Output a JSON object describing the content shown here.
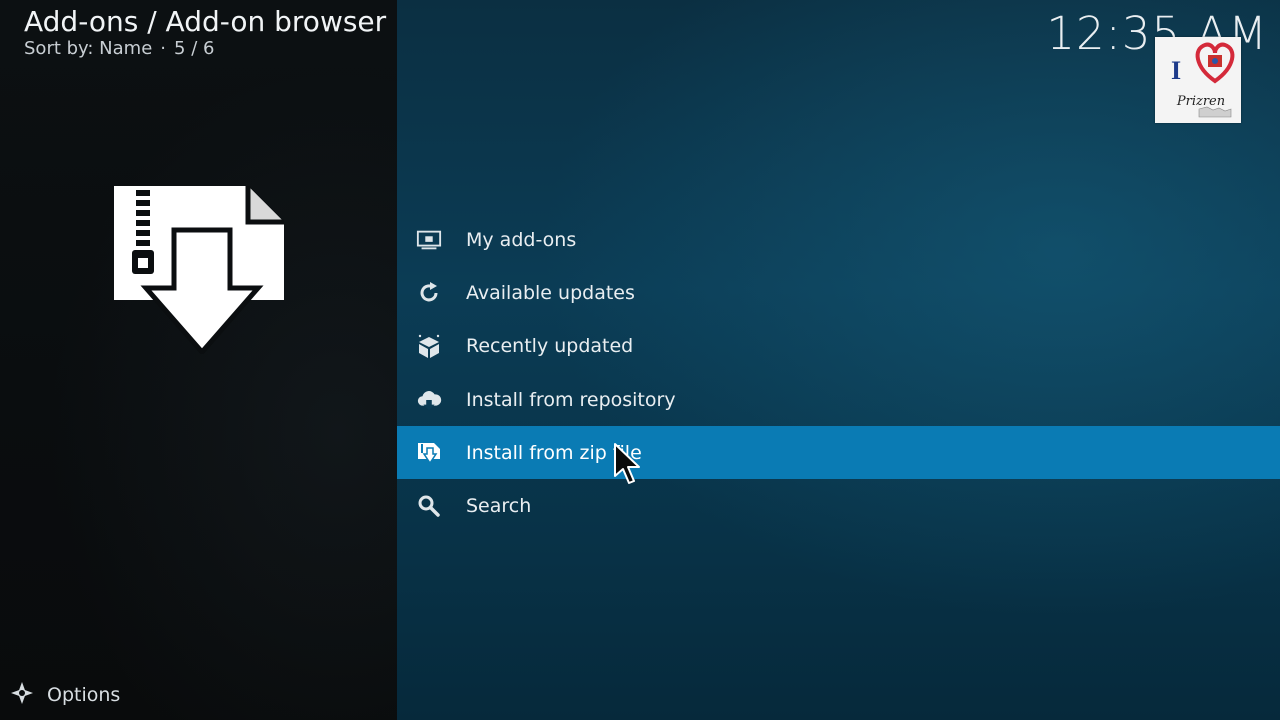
{
  "header": {
    "breadcrumb": "Add-ons / Add-on browser",
    "sort_label": "Sort by: Name",
    "separator": "·",
    "position": "5 / 6"
  },
  "clock": "12:35 AM",
  "logo": {
    "text_i": "I",
    "script": "Prizren"
  },
  "menu": {
    "items": [
      {
        "label": "My add-ons",
        "icon": "monitor-icon"
      },
      {
        "label": "Available updates",
        "icon": "refresh-icon"
      },
      {
        "label": "Recently updated",
        "icon": "box-icon"
      },
      {
        "label": "Install from repository",
        "icon": "cloud-download-icon"
      },
      {
        "label": "Install from zip file",
        "icon": "zip-install-icon",
        "selected": true
      },
      {
        "label": "Search",
        "icon": "search-icon"
      }
    ]
  },
  "footer": {
    "options_label": "Options"
  },
  "colors": {
    "selection": "#0a7bb4",
    "background_right": "#0b3c55",
    "background_left": "#0a0d0f"
  }
}
